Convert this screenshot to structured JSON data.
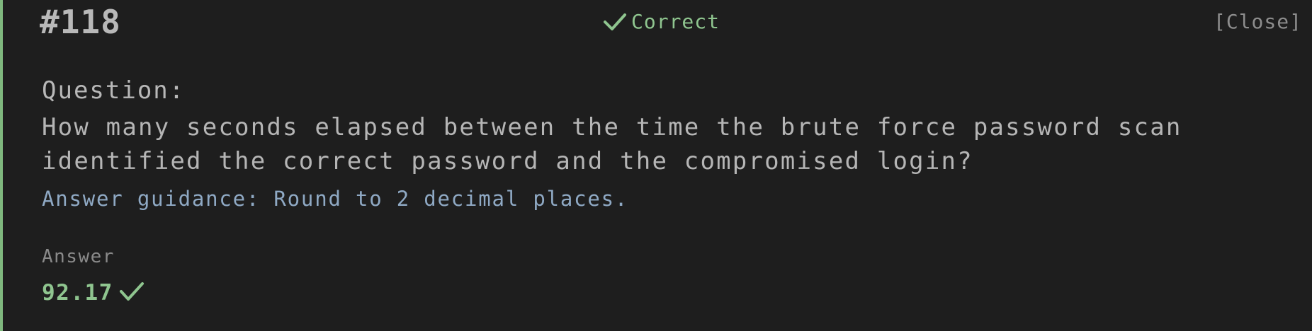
{
  "header": {
    "question_id": "#118",
    "status_label": "Correct",
    "close_label": "[Close]"
  },
  "question": {
    "label": "Question:",
    "text": "How many seconds elapsed between the time the brute force password scan identified the correct password and the compromised login?",
    "guidance": "Answer guidance: Round to 2 decimal places."
  },
  "answer": {
    "label": "Answer",
    "value": "92.17"
  },
  "icons": {
    "status": "checkmark-icon",
    "answer": "checkmark-icon"
  },
  "colors": {
    "accent_green": "#8fc58f",
    "border_green": "#7fb77e",
    "guidance_blue": "#8fa9c4",
    "background": "#1e1e1e"
  }
}
